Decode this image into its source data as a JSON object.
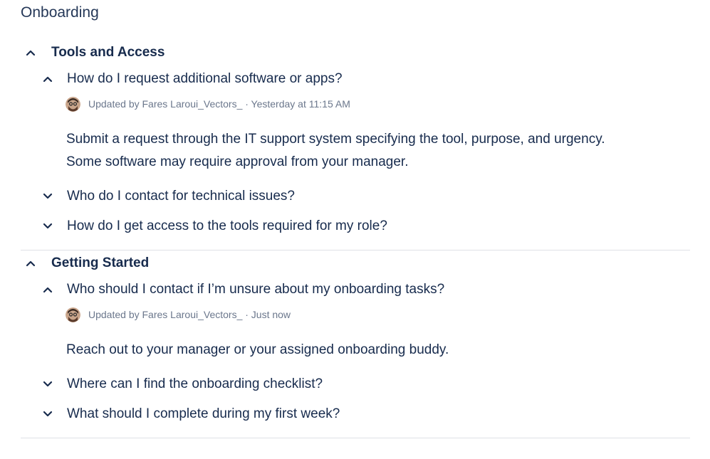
{
  "page": {
    "title": "Onboarding"
  },
  "sections": [
    {
      "title": "Tools and Access",
      "items": [
        {
          "question": "How do I request additional software or apps?",
          "expanded": true,
          "meta": "Updated by Fares Laroui_Vectors_ · Yesterday at 11:15 AM",
          "answer": "Submit a request through the IT support system specifying the tool, purpose, and urgency. Some software may require approval from your manager."
        },
        {
          "question": "Who do I contact for technical issues?",
          "expanded": false
        },
        {
          "question": "How do I get access to the tools required for my role?",
          "expanded": false
        }
      ]
    },
    {
      "title": "Getting Started",
      "items": [
        {
          "question": "Who should I contact if I’m unsure about my onboarding tasks?",
          "expanded": true,
          "meta": "Updated by Fares Laroui_Vectors_ · Just now",
          "answer": "Reach out to your manager or your assigned onboarding buddy."
        },
        {
          "question": "Where can I find the onboarding checklist?",
          "expanded": false
        },
        {
          "question": "What should I complete during my first week?",
          "expanded": false
        }
      ]
    }
  ],
  "icons": {
    "collapse": "chevron-up-icon",
    "expand": "chevron-down-icon"
  },
  "colors": {
    "text": "#172b4d",
    "meta": "#6b778c",
    "divider": "#dfe1e6"
  }
}
